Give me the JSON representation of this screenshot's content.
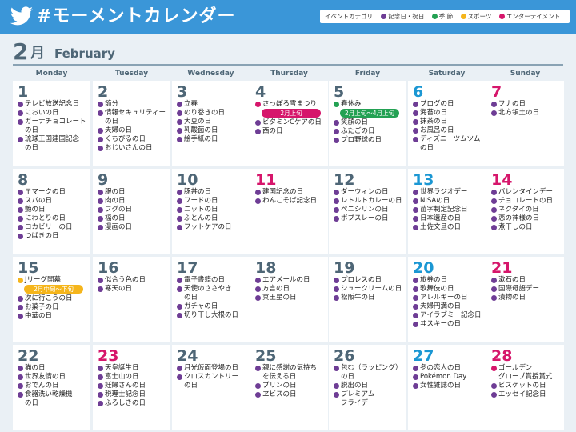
{
  "header": {
    "title": "#モーメントカレンダー"
  },
  "legend": {
    "label": "イベントカテゴリ",
    "items": [
      {
        "label": "記念日・祝日",
        "color": "#6e3d95"
      },
      {
        "label": "季 節",
        "color": "#23a153"
      },
      {
        "label": "スポーツ",
        "color": "#f5b51b"
      },
      {
        "label": "エンターテイメント",
        "color": "#d6166b"
      }
    ]
  },
  "month": {
    "number": "2",
    "kanji": "月",
    "english": "February"
  },
  "weekdays": [
    "Monday",
    "Tuesday",
    "Wednesday",
    "Thursday",
    "Friday",
    "Saturday",
    "Sunday"
  ],
  "colors": {
    "anniv": "#6e3d95",
    "season": "#23a153",
    "sport": "#f5b51b",
    "ent": "#d6166b"
  },
  "days": [
    {
      "d": "1",
      "style": "",
      "events": [
        {
          "c": "anniv",
          "lines": [
            "テレビ放送記念日"
          ]
        },
        {
          "c": "anniv",
          "lines": [
            "においの日"
          ]
        },
        {
          "c": "anniv",
          "lines": [
            "ガーナチョコレート",
            "の日"
          ]
        },
        {
          "c": "anniv",
          "lines": [
            "琉球王国建国記念",
            "の日"
          ]
        }
      ]
    },
    {
      "d": "2",
      "style": "",
      "events": [
        {
          "c": "anniv",
          "lines": [
            "節分"
          ]
        },
        {
          "c": "anniv",
          "lines": [
            "情報セキュリティー",
            "の日"
          ]
        },
        {
          "c": "anniv",
          "lines": [
            "夫婦の日"
          ]
        },
        {
          "c": "anniv",
          "lines": [
            "くちびるの日"
          ]
        },
        {
          "c": "anniv",
          "lines": [
            "おじいさんの日"
          ]
        }
      ]
    },
    {
      "d": "3",
      "style": "",
      "events": [
        {
          "c": "anniv",
          "lines": [
            "立春"
          ]
        },
        {
          "c": "anniv",
          "lines": [
            "のり巻きの日"
          ]
        },
        {
          "c": "anniv",
          "lines": [
            "大豆の日"
          ]
        },
        {
          "c": "anniv",
          "lines": [
            "乳酸菌の日"
          ]
        },
        {
          "c": "anniv",
          "lines": [
            "絵手紙の日"
          ]
        }
      ]
    },
    {
      "d": "4",
      "style": "",
      "events": [
        {
          "c": "ent",
          "lines": [
            "さっぽろ雪まつり"
          ],
          "badge": "2月上旬"
        },
        {
          "c": "anniv",
          "lines": [
            "ビタミンCケアの日"
          ]
        },
        {
          "c": "anniv",
          "lines": [
            "西の日"
          ]
        }
      ]
    },
    {
      "d": "5",
      "style": "",
      "events": [
        {
          "c": "season",
          "lines": [
            "春休み"
          ],
          "badge": "2月上旬〜4月上旬"
        },
        {
          "c": "anniv",
          "lines": [
            "笑顔の日"
          ]
        },
        {
          "c": "anniv",
          "lines": [
            "ふたごの日"
          ]
        },
        {
          "c": "anniv",
          "lines": [
            "プロ野球の日"
          ]
        }
      ]
    },
    {
      "d": "6",
      "style": "sat",
      "events": [
        {
          "c": "anniv",
          "lines": [
            "ブログの日"
          ]
        },
        {
          "c": "anniv",
          "lines": [
            "海苔の日"
          ]
        },
        {
          "c": "anniv",
          "lines": [
            "抹茶の日"
          ]
        },
        {
          "c": "anniv",
          "lines": [
            "お風呂の日"
          ]
        },
        {
          "c": "anniv",
          "lines": [
            "ディズニーツムツム",
            "の日"
          ]
        }
      ]
    },
    {
      "d": "7",
      "style": "sun",
      "events": [
        {
          "c": "anniv",
          "lines": [
            "フナの日"
          ]
        },
        {
          "c": "anniv",
          "lines": [
            "北方領土の日"
          ]
        }
      ]
    },
    {
      "d": "8",
      "style": "",
      "events": [
        {
          "c": "anniv",
          "lines": [
            "〒マークの日"
          ]
        },
        {
          "c": "anniv",
          "lines": [
            "スパの日"
          ]
        },
        {
          "c": "anniv",
          "lines": [
            "艶の日"
          ]
        },
        {
          "c": "anniv",
          "lines": [
            "にわとりの日"
          ]
        },
        {
          "c": "anniv",
          "lines": [
            "ロカビリーの日"
          ]
        },
        {
          "c": "anniv",
          "lines": [
            "つばきの日"
          ]
        }
      ]
    },
    {
      "d": "9",
      "style": "",
      "events": [
        {
          "c": "anniv",
          "lines": [
            "服の日"
          ]
        },
        {
          "c": "anniv",
          "lines": [
            "肉の日"
          ]
        },
        {
          "c": "anniv",
          "lines": [
            "フグの日"
          ]
        },
        {
          "c": "anniv",
          "lines": [
            "福の日"
          ]
        },
        {
          "c": "anniv",
          "lines": [
            "漫画の日"
          ]
        }
      ]
    },
    {
      "d": "10",
      "style": "",
      "events": [
        {
          "c": "anniv",
          "lines": [
            "豚丼の日"
          ]
        },
        {
          "c": "anniv",
          "lines": [
            "フードの日"
          ]
        },
        {
          "c": "anniv",
          "lines": [
            "ニットの日"
          ]
        },
        {
          "c": "anniv",
          "lines": [
            "ふとんの日"
          ]
        },
        {
          "c": "anniv",
          "lines": [
            "フットケアの日"
          ]
        }
      ]
    },
    {
      "d": "11",
      "style": "hol",
      "events": [
        {
          "c": "anniv",
          "lines": [
            "建国記念の日"
          ]
        },
        {
          "c": "anniv",
          "lines": [
            "わんこそば記念日"
          ]
        }
      ]
    },
    {
      "d": "12",
      "style": "",
      "events": [
        {
          "c": "anniv",
          "lines": [
            "ダーウィンの日"
          ]
        },
        {
          "c": "anniv",
          "lines": [
            "レトルトカレーの日"
          ]
        },
        {
          "c": "anniv",
          "lines": [
            "ペニシリンの日"
          ]
        },
        {
          "c": "anniv",
          "lines": [
            "ボブスレーの日"
          ]
        }
      ]
    },
    {
      "d": "13",
      "style": "sat",
      "events": [
        {
          "c": "anniv",
          "lines": [
            "世界ラジオデー"
          ]
        },
        {
          "c": "anniv",
          "lines": [
            "NISAの日"
          ]
        },
        {
          "c": "anniv",
          "lines": [
            "苗字制定記念日"
          ]
        },
        {
          "c": "anniv",
          "lines": [
            "日本遺産の日"
          ]
        },
        {
          "c": "anniv",
          "lines": [
            "土佐文旦の日"
          ]
        }
      ]
    },
    {
      "d": "14",
      "style": "sun",
      "events": [
        {
          "c": "anniv",
          "lines": [
            "バレンタインデー"
          ]
        },
        {
          "c": "anniv",
          "lines": [
            "チョコレートの日"
          ]
        },
        {
          "c": "anniv",
          "lines": [
            "ネクタイの日"
          ]
        },
        {
          "c": "anniv",
          "lines": [
            "恋の神様の日"
          ]
        },
        {
          "c": "anniv",
          "lines": [
            "煮干しの日"
          ]
        }
      ]
    },
    {
      "d": "15",
      "style": "",
      "events": [
        {
          "c": "sport",
          "lines": [
            "Jリーグ開幕"
          ],
          "badge": "2月中旬〜下旬"
        },
        {
          "c": "anniv",
          "lines": [
            "次に行こうの日"
          ]
        },
        {
          "c": "anniv",
          "lines": [
            "お菓子の日"
          ]
        },
        {
          "c": "anniv",
          "lines": [
            "中華の日"
          ]
        }
      ]
    },
    {
      "d": "16",
      "style": "",
      "events": [
        {
          "c": "anniv",
          "lines": [
            "似合う色の日"
          ]
        },
        {
          "c": "anniv",
          "lines": [
            "寒天の日"
          ]
        }
      ]
    },
    {
      "d": "17",
      "style": "",
      "events": [
        {
          "c": "anniv",
          "lines": [
            "電子書籍の日"
          ]
        },
        {
          "c": "anniv",
          "lines": [
            "天使のささやき",
            "の日"
          ]
        },
        {
          "c": "anniv",
          "lines": [
            "ガチャの日"
          ]
        },
        {
          "c": "anniv",
          "lines": [
            "切り干し大根の日"
          ]
        }
      ]
    },
    {
      "d": "18",
      "style": "",
      "events": [
        {
          "c": "anniv",
          "lines": [
            "エアメールの日"
          ]
        },
        {
          "c": "anniv",
          "lines": [
            "方言の日"
          ]
        },
        {
          "c": "anniv",
          "lines": [
            "冥王星の日"
          ]
        }
      ]
    },
    {
      "d": "19",
      "style": "",
      "events": [
        {
          "c": "anniv",
          "lines": [
            "プロレスの日"
          ]
        },
        {
          "c": "anniv",
          "lines": [
            "シュークリームの日"
          ]
        },
        {
          "c": "anniv",
          "lines": [
            "松阪牛の日"
          ]
        }
      ]
    },
    {
      "d": "20",
      "style": "sat",
      "events": [
        {
          "c": "anniv",
          "lines": [
            "旅券の日"
          ]
        },
        {
          "c": "anniv",
          "lines": [
            "歌舞伎の日"
          ]
        },
        {
          "c": "anniv",
          "lines": [
            "アレルギーの日"
          ]
        },
        {
          "c": "anniv",
          "lines": [
            "夫婦円満の日"
          ]
        },
        {
          "c": "anniv",
          "lines": [
            "アイラブミー記念日"
          ]
        },
        {
          "c": "anniv",
          "lines": [
            "ヰスキーの日"
          ]
        }
      ]
    },
    {
      "d": "21",
      "style": "sun",
      "events": [
        {
          "c": "anniv",
          "lines": [
            "漱石の日"
          ]
        },
        {
          "c": "anniv",
          "lines": [
            "国際母語デー"
          ]
        },
        {
          "c": "anniv",
          "lines": [
            "漬物の日"
          ]
        }
      ]
    },
    {
      "d": "22",
      "style": "",
      "events": [
        {
          "c": "anniv",
          "lines": [
            "猫の日"
          ]
        },
        {
          "c": "anniv",
          "lines": [
            "世界友情の日"
          ]
        },
        {
          "c": "anniv",
          "lines": [
            "おでんの日"
          ]
        },
        {
          "c": "anniv",
          "lines": [
            "食器洗い乾燥機",
            "の日"
          ]
        }
      ]
    },
    {
      "d": "23",
      "style": "hol",
      "events": [
        {
          "c": "anniv",
          "lines": [
            "天皇誕生日"
          ]
        },
        {
          "c": "anniv",
          "lines": [
            "富士山の日"
          ]
        },
        {
          "c": "anniv",
          "lines": [
            "妊婦さんの日"
          ]
        },
        {
          "c": "anniv",
          "lines": [
            "税理士記念日"
          ]
        },
        {
          "c": "anniv",
          "lines": [
            "ふろしきの日"
          ]
        }
      ]
    },
    {
      "d": "24",
      "style": "",
      "events": [
        {
          "c": "anniv",
          "lines": [
            "月光仮面登場の日"
          ]
        },
        {
          "c": "anniv",
          "lines": [
            "クロスカントリー",
            "の日"
          ]
        }
      ]
    },
    {
      "d": "25",
      "style": "",
      "events": [
        {
          "c": "anniv",
          "lines": [
            "親に感謝の気持ち",
            "を伝える日"
          ]
        },
        {
          "c": "anniv",
          "lines": [
            "プリンの日"
          ]
        },
        {
          "c": "anniv",
          "lines": [
            "ヱビスの日"
          ]
        }
      ]
    },
    {
      "d": "26",
      "style": "",
      "events": [
        {
          "c": "anniv",
          "lines": [
            "包む（ラッピング）",
            "の日"
          ]
        },
        {
          "c": "anniv",
          "lines": [
            "脱出の日"
          ]
        },
        {
          "c": "anniv",
          "lines": [
            "プレミアム",
            "フライデー"
          ]
        }
      ]
    },
    {
      "d": "27",
      "style": "sat",
      "events": [
        {
          "c": "anniv",
          "lines": [
            "冬の恋人の日"
          ]
        },
        {
          "c": "anniv",
          "lines": [
            "Pokémon Day"
          ]
        },
        {
          "c": "anniv",
          "lines": [
            "女性雑誌の日"
          ]
        }
      ]
    },
    {
      "d": "28",
      "style": "sun",
      "events": [
        {
          "c": "ent",
          "lines": [
            "ゴールデン",
            "グローブ賞授賞式"
          ]
        },
        {
          "c": "anniv",
          "lines": [
            "ビスケットの日"
          ]
        },
        {
          "c": "anniv",
          "lines": [
            "エッセイ記念日"
          ]
        }
      ]
    }
  ]
}
